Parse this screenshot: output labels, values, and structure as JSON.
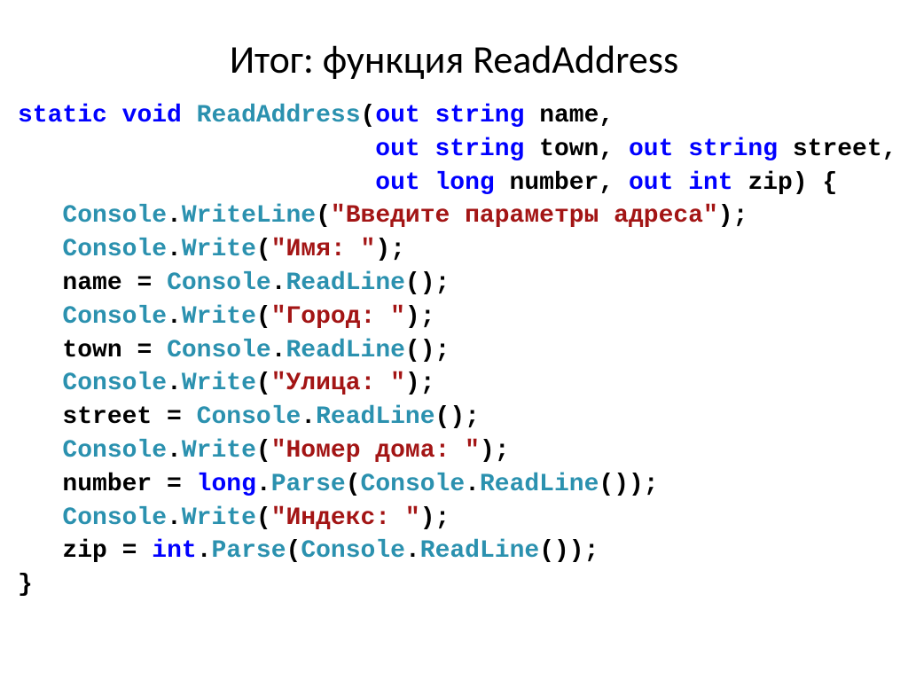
{
  "slide": {
    "title": "Итог: функция ReadAddress"
  },
  "code": {
    "kw_static": "static",
    "kw_void": "void",
    "fn_name": "ReadAddress",
    "kw_out": "out",
    "kw_string": "string",
    "kw_long": "long",
    "kw_int": "int",
    "param_name": "name",
    "param_town": "town",
    "param_street": "street",
    "param_number": "number",
    "param_zip": "zip",
    "console": "Console",
    "writeline": "WriteLine",
    "write": "Write",
    "readline": "ReadLine",
    "parse": "Parse",
    "long_type": "long",
    "int_type": "int",
    "str_prompt": "\"Введите параметры адреса\"",
    "str_name": "\"Имя: \"",
    "str_town": "\"Город: \"",
    "str_street": "\"Улица: \"",
    "str_number": "\"Номер дома: \"",
    "str_zip": "\"Индекс: \"",
    "var_name": "name",
    "var_town": "town",
    "var_street": "street",
    "var_number": "number",
    "var_zip": "zip"
  }
}
